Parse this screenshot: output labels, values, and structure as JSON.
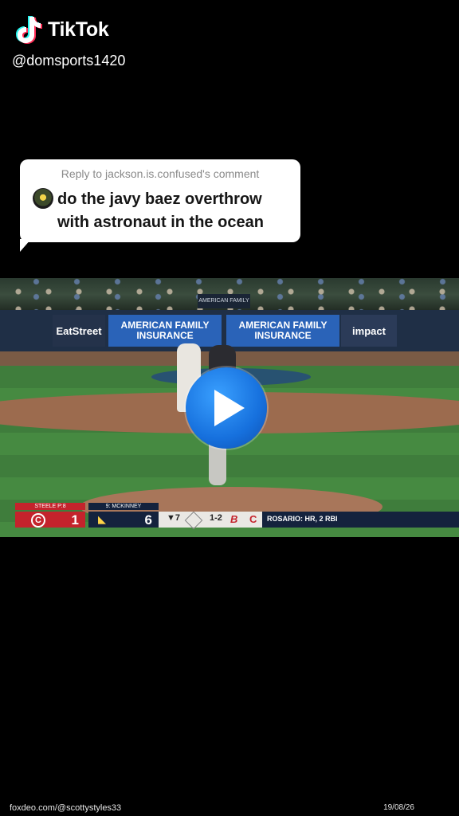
{
  "tiktok": {
    "brand": "TikTok",
    "handle": "@domsports1420"
  },
  "reply": {
    "reply_to": "Reply to jackson.is.confused's comment",
    "line1": "do the javy baez overthrow",
    "line2": "with astronaut in the ocean"
  },
  "video": {
    "play_icon": "play-icon",
    "ads": {
      "eatstreet": "EatStreet",
      "afi_line1": "AMERICAN FAMILY",
      "afi_line2": "INSURANCE",
      "impact": "impact"
    },
    "scorebug": {
      "pitcher_label": "STEELE P:8",
      "batter_label": "9: MCKINNEY",
      "home_score": "1",
      "away_score": "6",
      "inning": "▼7",
      "count": "1-2",
      "event": "ROSARIO: HR, 2 RBI"
    }
  },
  "footer": {
    "source": "foxdeo.com/@scottystyles33",
    "date": "19/08/26"
  },
  "colors": {
    "background": "#000000",
    "play_button": "#1670dd",
    "scorebug_red": "#c4232c",
    "scorebug_navy": "#14223d"
  }
}
